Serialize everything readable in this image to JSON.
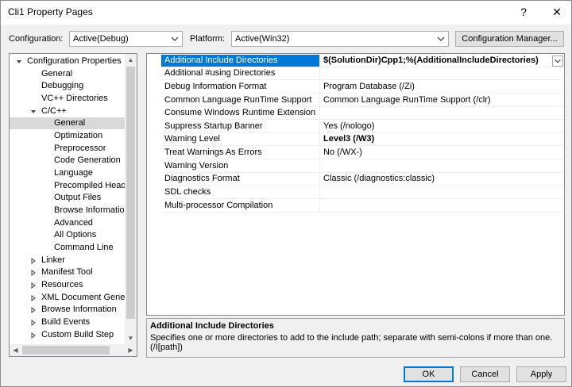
{
  "window": {
    "title": "Cli1 Property Pages",
    "help": "?",
    "close": "✕"
  },
  "config": {
    "config_label": "Configuration:",
    "config_value": "Active(Debug)",
    "platform_label": "Platform:",
    "platform_value": "Active(Win32)",
    "manager_button": "Configuration Manager..."
  },
  "tree": {
    "items": [
      {
        "label": "Configuration Properties"
      },
      {
        "label": "General"
      },
      {
        "label": "Debugging"
      },
      {
        "label": "VC++ Directories"
      },
      {
        "label": "C/C++"
      },
      {
        "label": "General"
      },
      {
        "label": "Optimization"
      },
      {
        "label": "Preprocessor"
      },
      {
        "label": "Code Generation"
      },
      {
        "label": "Language"
      },
      {
        "label": "Precompiled Heade"
      },
      {
        "label": "Output Files"
      },
      {
        "label": "Browse Information"
      },
      {
        "label": "Advanced"
      },
      {
        "label": "All Options"
      },
      {
        "label": "Command Line"
      },
      {
        "label": "Linker"
      },
      {
        "label": "Manifest Tool"
      },
      {
        "label": "Resources"
      },
      {
        "label": "XML Document Genera"
      },
      {
        "label": "Browse Information"
      },
      {
        "label": "Build Events"
      },
      {
        "label": "Custom Build Step"
      }
    ]
  },
  "properties": {
    "rows": [
      {
        "name": "Additional Include Directories",
        "value": "$(SolutionDir)Cpp1;%(AdditionalIncludeDirectories)"
      },
      {
        "name": "Additional #using Directories",
        "value": ""
      },
      {
        "name": "Debug Information Format",
        "value": "Program Database (/Zi)"
      },
      {
        "name": "Common Language RunTime Support",
        "value": "Common Language RunTime Support (/clr)"
      },
      {
        "name": "Consume Windows Runtime Extension",
        "value": ""
      },
      {
        "name": "Suppress Startup Banner",
        "value": "Yes (/nologo)"
      },
      {
        "name": "Warning Level",
        "value": "Level3 (/W3)"
      },
      {
        "name": "Treat Warnings As Errors",
        "value": "No (/WX-)"
      },
      {
        "name": "Warning Version",
        "value": ""
      },
      {
        "name": "Diagnostics Format",
        "value": "Classic (/diagnostics:classic)"
      },
      {
        "name": "SDL checks",
        "value": ""
      },
      {
        "name": "Multi-processor Compilation",
        "value": ""
      }
    ]
  },
  "description": {
    "title": "Additional Include Directories",
    "text": "Specifies one or more directories to add to the include path; separate with semi-colons if more than one. (/I[path])"
  },
  "buttons": {
    "ok": "OK",
    "cancel": "Cancel",
    "apply": "Apply"
  }
}
